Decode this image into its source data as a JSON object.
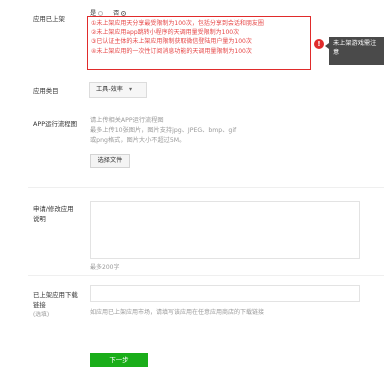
{
  "app_online": {
    "label": "应用已上架",
    "options": [
      {
        "label": "是",
        "checked": false
      },
      {
        "label": "否",
        "checked": true
      }
    ],
    "warnings": [
      "①未上架应用天分享最受限制为100次，包括分享到会话和朋友圈",
      "②未上架应用app跳转小程序的天调用量受限制为100次",
      "③已认证主体的未上架应用限制获取微信登陆用户量为100次",
      "④未上架应用的一次性订阅消息功能的天调用量限制为100次"
    ],
    "tooltip": "未上架游戏需注意",
    "warn_icon": "!"
  },
  "category": {
    "label": "应用类目",
    "value": "工具-效率",
    "arrow": "▾"
  },
  "flowchart": {
    "label": "APP运行流程图",
    "hints": [
      "请上传相关APP运行流程图",
      "最多上传10张图片，图片支持jpg、JPEG、bmp、gif",
      "或png格式，图片大小不超过5M。"
    ],
    "button": "选择文件"
  },
  "modify": {
    "label_line1": "申请/修改应用",
    "label_line2": "说明",
    "hint": "最多200字"
  },
  "download": {
    "label_line1": "已上架应用下载",
    "label_line2": "链接",
    "label_line3": "(选填)",
    "hint": "如应用已上架应用市场，请填写该应用在任意应用商店的下载链接"
  },
  "actions": {
    "next": "下一步"
  },
  "colors": {
    "warning_red": "#e64545",
    "primary_green": "#1aad19",
    "tooltip_bg": "#4a4a4a"
  }
}
